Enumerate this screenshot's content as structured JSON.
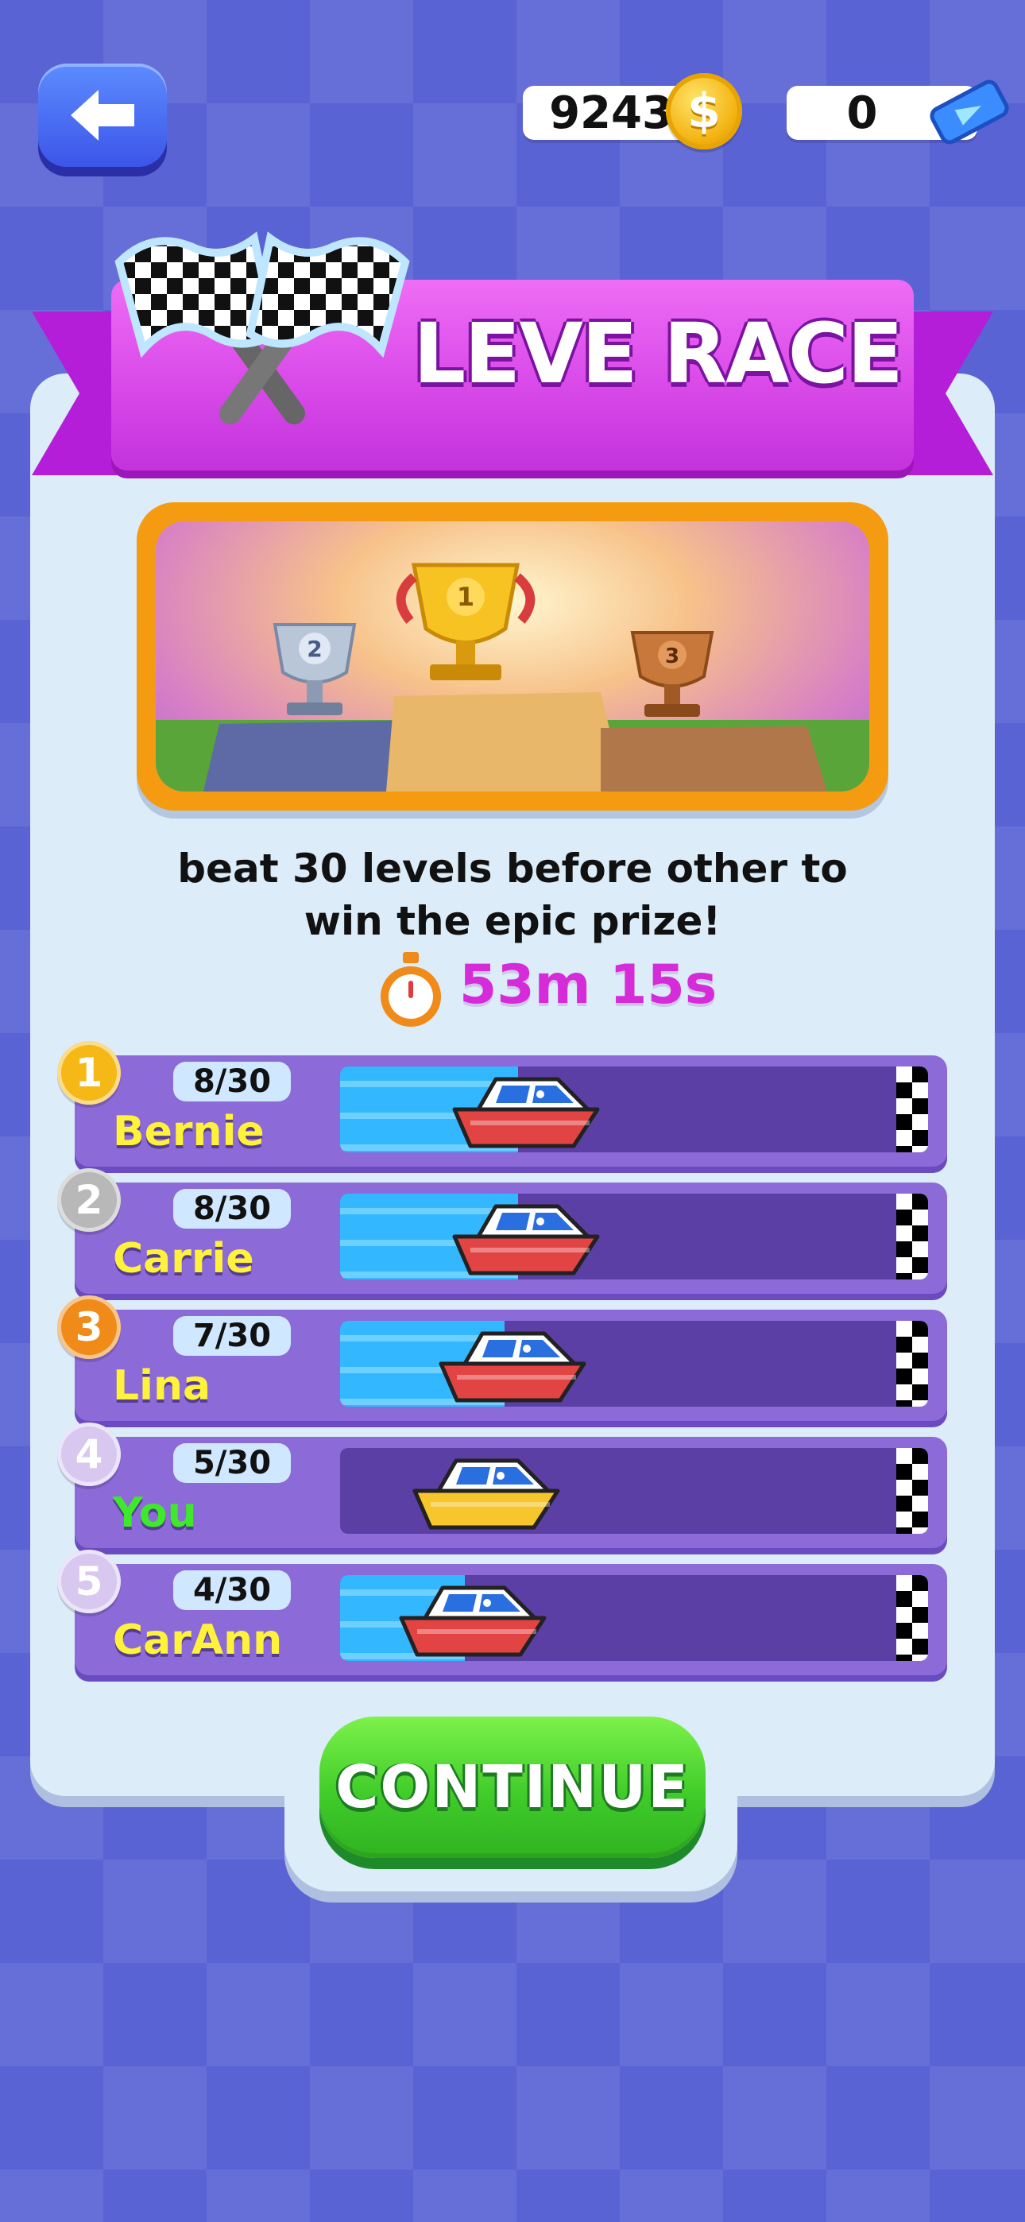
{
  "header": {
    "coins": "9243",
    "tickets": "0"
  },
  "banner": {
    "title": "LEVE RACE"
  },
  "description": {
    "line1": "beat 30 levels before other to",
    "line2": "win the epic prize!"
  },
  "timer": {
    "value": "53m 15s"
  },
  "leaderboard": [
    {
      "rank": "1",
      "name": "Bernie",
      "score": "8/30",
      "progress": 0.267,
      "name_color": "#fff23a",
      "boat": "red",
      "medal_color": "#f5b816"
    },
    {
      "rank": "2",
      "name": "Carrie",
      "score": "8/30",
      "progress": 0.267,
      "name_color": "#fff23a",
      "boat": "red",
      "medal_color": "#b8b8b8"
    },
    {
      "rank": "3",
      "name": "Lina",
      "score": "7/30",
      "progress": 0.233,
      "name_color": "#fff23a",
      "boat": "red",
      "medal_color": "#f08a18"
    },
    {
      "rank": "4",
      "name": "You",
      "score": "5/30",
      "progress": 0.167,
      "name_color": "#3ee82a",
      "boat": "yellow",
      "medal_color": "#d8c8f0"
    },
    {
      "rank": "5",
      "name": "CarAnn",
      "score": "4/30",
      "progress": 0.133,
      "name_color": "#fff23a",
      "boat": "red",
      "medal_color": "#d8c8f0"
    }
  ],
  "buttons": {
    "continue": "CONTINUE"
  },
  "colors": {
    "banner": "#d94ae9",
    "panel": "#dcecf8",
    "continue": "#40cc2a",
    "timer": "#d62bd8"
  },
  "icons": [
    "back-arrow-icon",
    "coin-icon",
    "ticket-icon",
    "checkered-flags-icon",
    "stopwatch-icon",
    "trophy-icon",
    "boat-icon",
    "finish-line-icon"
  ]
}
